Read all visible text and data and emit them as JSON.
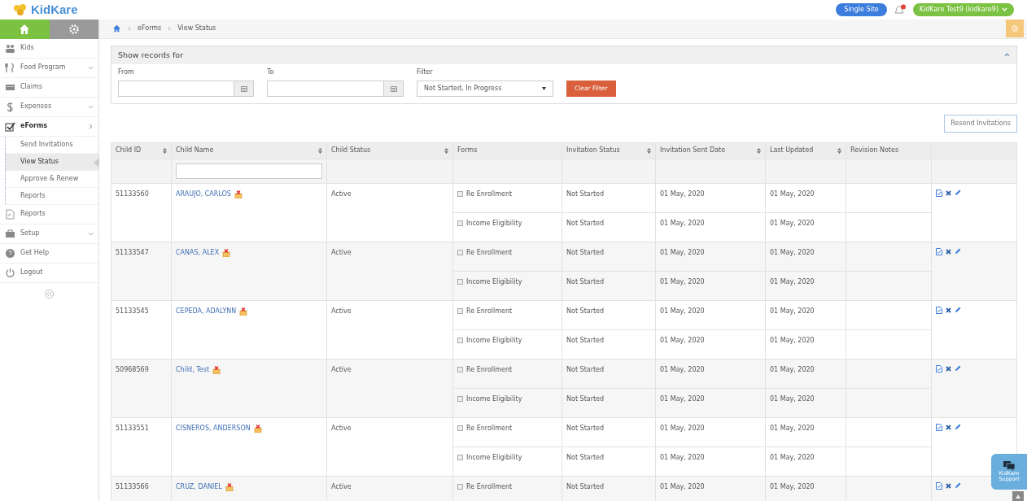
{
  "header": {
    "logo_text": "KidKare",
    "site_button": "Single Site",
    "user_button": "KidKare Test9 (kidkare9)"
  },
  "sidebar": {
    "tabs": [
      {
        "kind": "home",
        "selected": true
      },
      {
        "kind": "settings",
        "selected": false
      }
    ],
    "items": [
      {
        "label": "Kids",
        "has_chevron": false,
        "expanded": false
      },
      {
        "label": "Food Program",
        "has_chevron": true,
        "expanded": false
      },
      {
        "label": "Claims",
        "has_chevron": false,
        "expanded": false
      },
      {
        "label": "Expenses",
        "has_chevron": true,
        "expanded": false
      },
      {
        "label": "eForms",
        "has_chevron": true,
        "expanded": true,
        "children": [
          {
            "label": "Send Invitations",
            "selected": false
          },
          {
            "label": "View Status",
            "selected": true
          },
          {
            "label": "Approve & Renew",
            "selected": false
          },
          {
            "label": "Reports",
            "selected": false
          }
        ]
      },
      {
        "label": "Reports",
        "has_chevron": false,
        "expanded": false
      },
      {
        "label": "Setup",
        "has_chevron": true,
        "expanded": false
      },
      {
        "label": "Get Help",
        "has_chevron": false,
        "expanded": false
      },
      {
        "label": "Logout",
        "has_chevron": false,
        "expanded": false
      }
    ]
  },
  "breadcrumb": [
    "eForms",
    "View Status"
  ],
  "filter_panel": {
    "title": "Show records for",
    "from_label": "From",
    "to_label": "To",
    "filter_label": "Filter",
    "filter_value": "Not Started, In Progress",
    "clear_button": "Clear Filter"
  },
  "resend_button": "Resend Invitations",
  "table": {
    "columns": [
      {
        "label": "Child ID",
        "sortable": true
      },
      {
        "label": "Child Name",
        "sortable": true
      },
      {
        "label": "Child Status",
        "sortable": true
      },
      {
        "label": "Forms",
        "sortable": false
      },
      {
        "label": "Invitation Status",
        "sortable": true
      },
      {
        "label": "Invitation Sent Date",
        "sortable": true
      },
      {
        "label": "Last Updated",
        "sortable": true
      },
      {
        "label": "Revision Notes",
        "sortable": false
      }
    ],
    "rows": [
      {
        "id": "51133560",
        "name": "ARAUJO, CARLOS",
        "status": "Active",
        "forms": [
          {
            "name": "Re Enrollment",
            "checked": false,
            "invitation_status": "Not Started",
            "sent": "01 May, 2020",
            "updated": "01 May, 2020"
          },
          {
            "name": "Income Eligibility",
            "checked": false,
            "invitation_status": "Not Started",
            "sent": "01 May, 2020",
            "updated": "01 May, 2020"
          }
        ]
      },
      {
        "id": "51133547",
        "name": "CANAS, ALEX",
        "status": "Active",
        "forms": [
          {
            "name": "Re Enrollment",
            "checked": false,
            "invitation_status": "Not Started",
            "sent": "01 May, 2020",
            "updated": "01 May, 2020"
          },
          {
            "name": "Income Eligibility",
            "checked": false,
            "invitation_status": "Not Started",
            "sent": "01 May, 2020",
            "updated": "01 May, 2020"
          }
        ]
      },
      {
        "id": "51133545",
        "name": "CEPEDA, ADALYNN",
        "status": "Active",
        "forms": [
          {
            "name": "Re Enrollment",
            "checked": false,
            "invitation_status": "Not Started",
            "sent": "01 May, 2020",
            "updated": "01 May, 2020"
          },
          {
            "name": "Income Eligibility",
            "checked": false,
            "invitation_status": "Not Started",
            "sent": "01 May, 2020",
            "updated": "01 May, 2020"
          }
        ]
      },
      {
        "id": "50968569",
        "name": "Child, Test",
        "status": "Active",
        "forms": [
          {
            "name": "Re Enrollment",
            "checked": false,
            "invitation_status": "Not Started",
            "sent": "01 May, 2020",
            "updated": "01 May, 2020"
          },
          {
            "name": "Income Eligibility",
            "checked": false,
            "invitation_status": "Not Started",
            "sent": "01 May, 2020",
            "updated": "01 May, 2020"
          }
        ]
      },
      {
        "id": "51133551",
        "name": "CISNEROS, ANDERSON",
        "status": "Active",
        "forms": [
          {
            "name": "Re Enrollment",
            "checked": false,
            "invitation_status": "Not Started",
            "sent": "01 May, 2020",
            "updated": "01 May, 2020"
          },
          {
            "name": "Income Eligibility",
            "checked": false,
            "invitation_status": "Not Started",
            "sent": "01 May, 2020",
            "updated": "01 May, 2020"
          }
        ]
      },
      {
        "id": "51133566",
        "name": "CRUZ, DANIEL",
        "status": "Active",
        "forms": [
          {
            "name": "Re Enrollment",
            "checked": false,
            "invitation_status": "Not Started",
            "sent": "01 May, 2020",
            "updated": "01 May, 2020"
          }
        ]
      }
    ]
  },
  "support_widget": {
    "label": "KidKare Support"
  }
}
